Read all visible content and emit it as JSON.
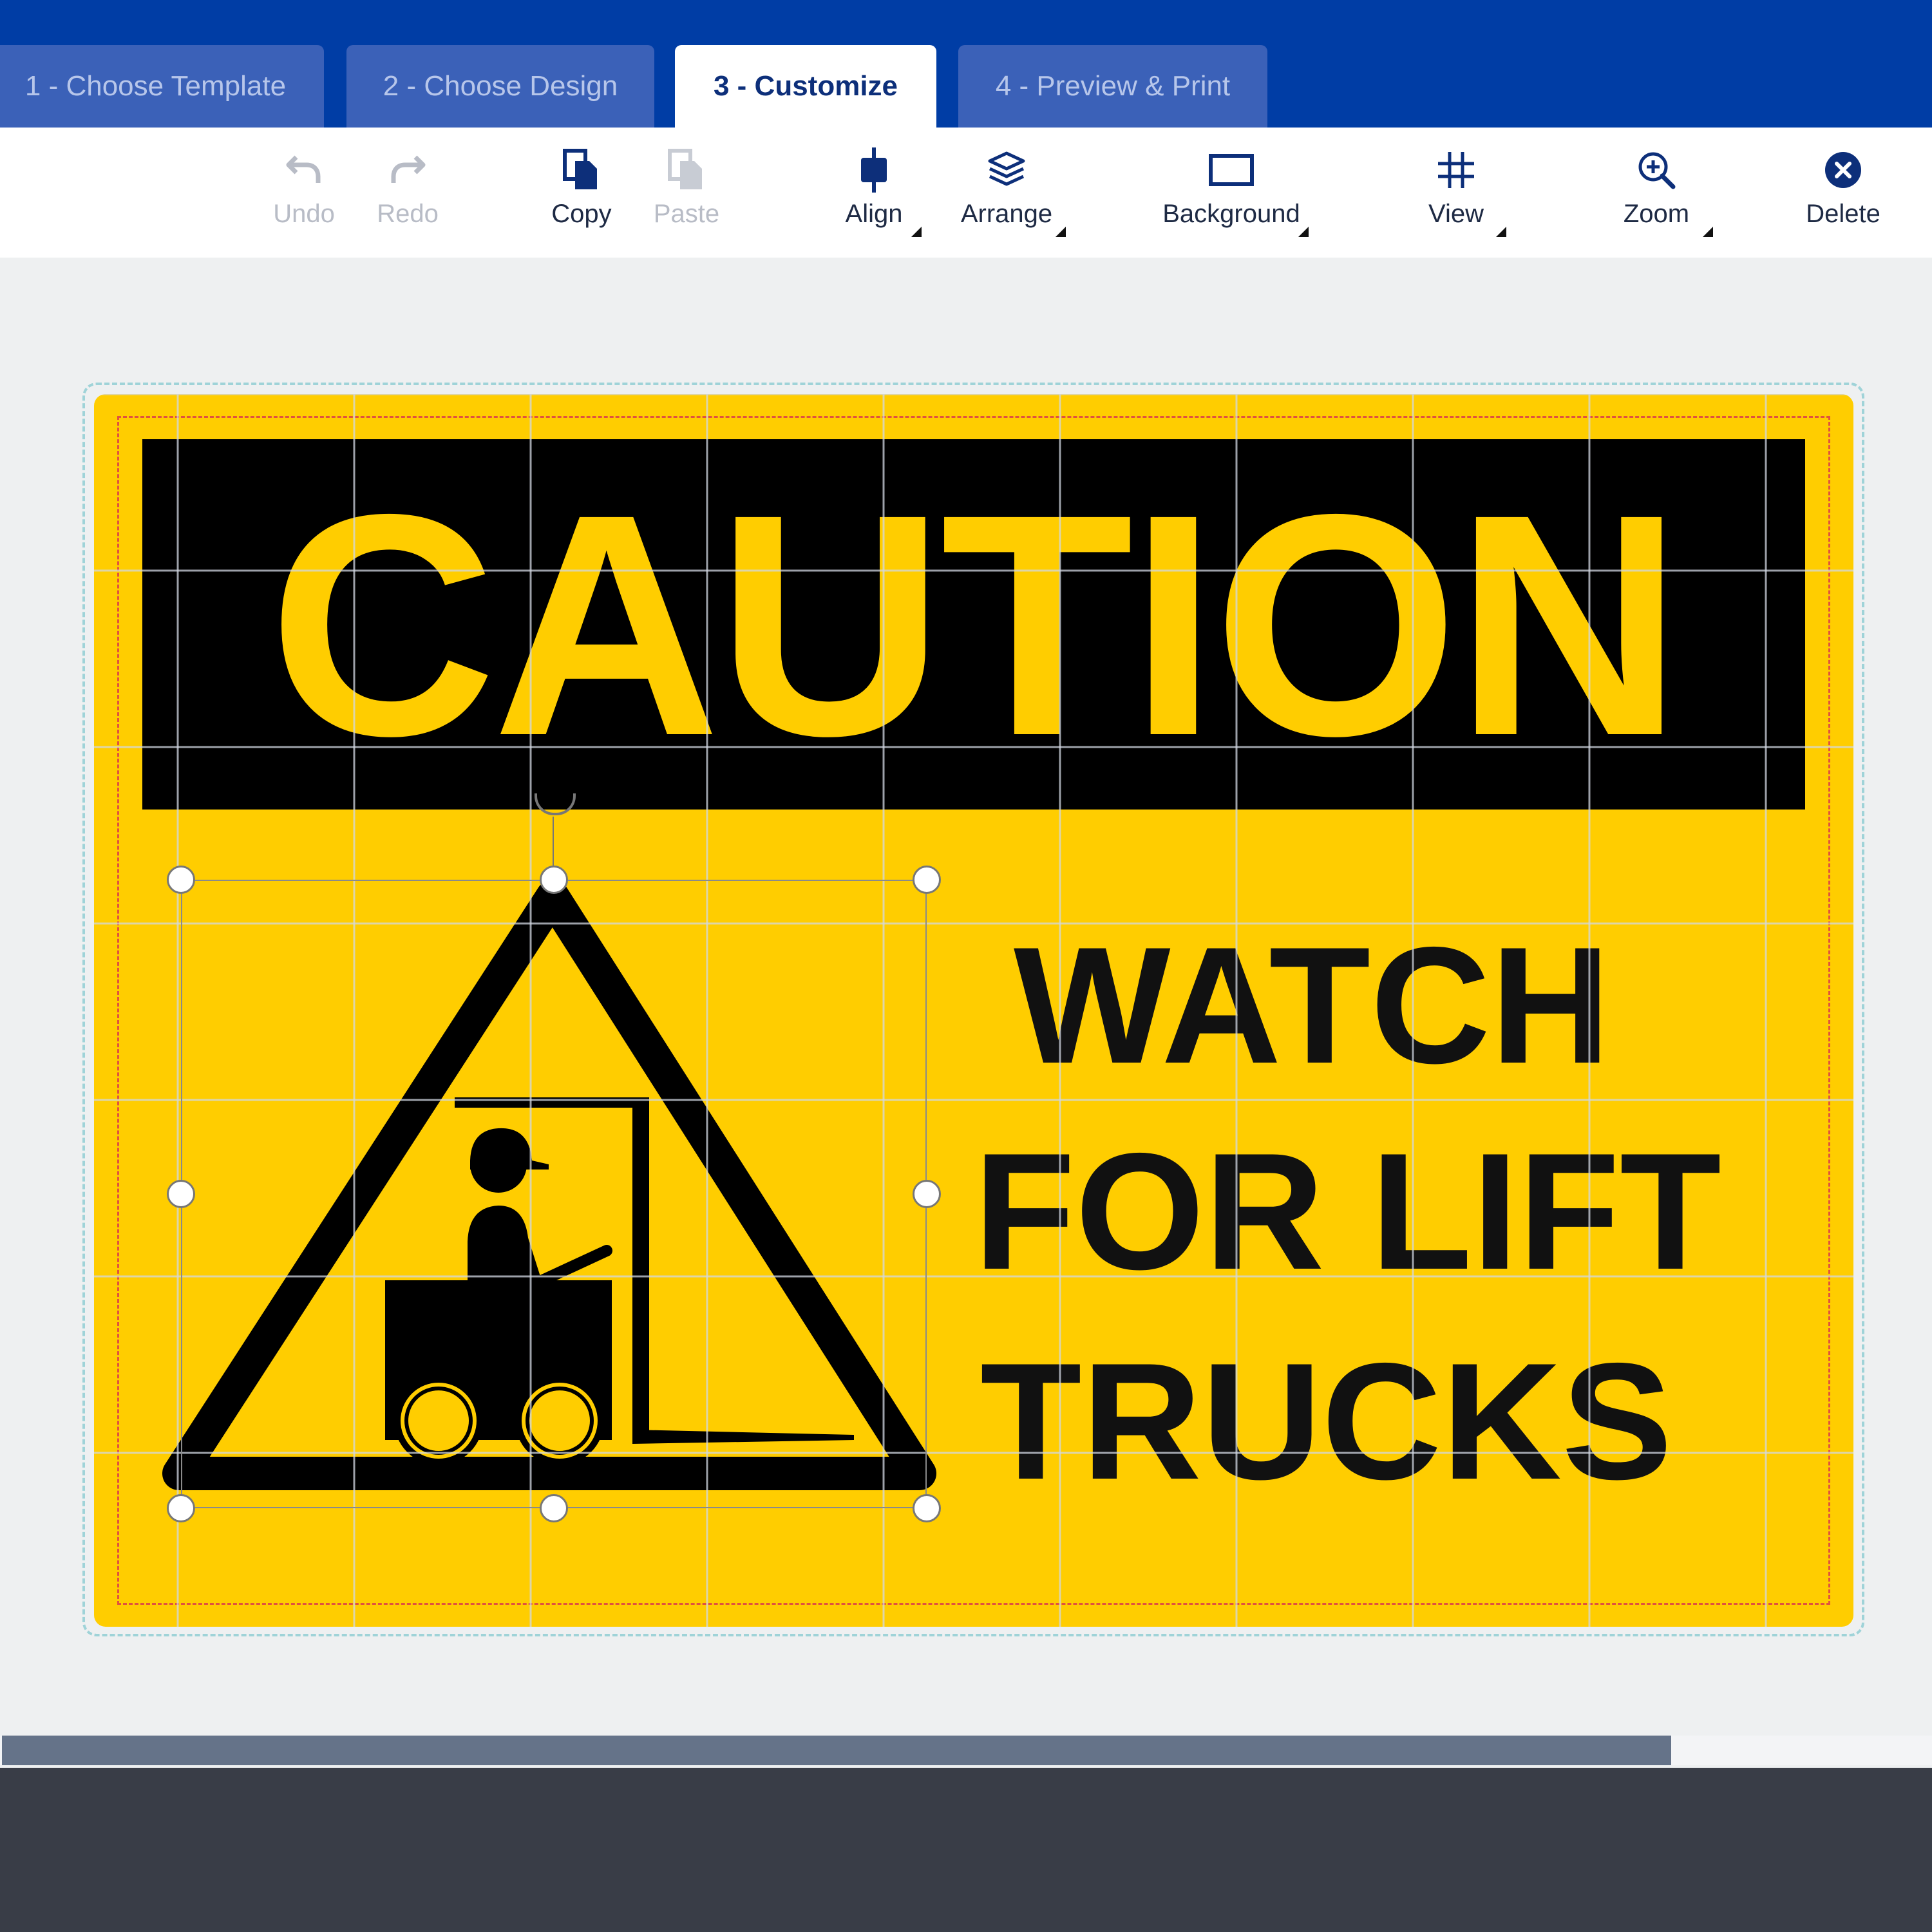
{
  "tabs": [
    {
      "label": "1 - Choose Template",
      "active": false
    },
    {
      "label": "2 - Choose Design",
      "active": false
    },
    {
      "label": "3 - Customize",
      "active": true
    },
    {
      "label": "4 - Preview & Print",
      "active": false
    }
  ],
  "toolbar": {
    "undo": "Undo",
    "redo": "Redo",
    "copy": "Copy",
    "paste": "Paste",
    "align": "Align",
    "arrange": "Arrange",
    "background": "Background",
    "view": "View",
    "zoom": "Zoom",
    "delete": "Delete"
  },
  "sign": {
    "header": "CAUTION",
    "lines": [
      "WATCH",
      "FOR LIFT",
      "TRUCKS"
    ],
    "background_color": "#ffcd00",
    "text_color": "#000000"
  },
  "colors": {
    "tab_bar": "#003da5",
    "active_tab_text": "#0d2f7a",
    "disabled_text": "#b8bcc6",
    "scroll_thumb": "#657389",
    "footer": "#393d47"
  },
  "icons": {
    "undo": "undo-icon",
    "redo": "redo-icon",
    "copy": "copy-icon",
    "paste": "paste-icon",
    "align": "align-icon",
    "arrange": "layers-icon",
    "background": "rectangle-icon",
    "view": "grid-icon",
    "zoom": "zoom-in-icon",
    "delete": "close-circle-icon",
    "sign_graphic": "forklift-warning-icon"
  }
}
